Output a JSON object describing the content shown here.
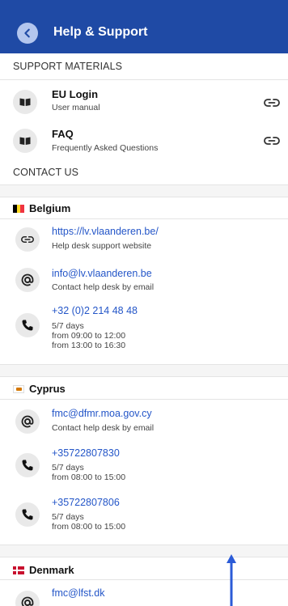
{
  "header": {
    "title": "Help & Support",
    "accent": "#1f4aa5"
  },
  "support_materials": {
    "heading": "SUPPORT MATERIALS",
    "items": [
      {
        "title": "EU Login",
        "subtitle": "User manual",
        "icon": "book-icon",
        "action_icon": "link-icon"
      },
      {
        "title": "FAQ",
        "subtitle": "Frequently Asked Questions",
        "icon": "book-icon",
        "action_icon": "link-icon"
      }
    ]
  },
  "contact": {
    "heading": "CONTACT US",
    "countries": [
      {
        "name": "Belgium",
        "flag_colors": [
          "#000000",
          "#fdda24",
          "#ef3340"
        ],
        "contacts": [
          {
            "icon": "link-icon",
            "link": "https://lv.vlaanderen.be/",
            "lines": [
              "Help desk support website"
            ]
          },
          {
            "icon": "at-icon",
            "link": "info@lv.vlaanderen.be",
            "lines": [
              "Contact help desk by email"
            ]
          },
          {
            "icon": "phone-icon",
            "link": "+32 (0)2 214 48 48",
            "lines": [
              "5/7 days",
              "from 09:00 to 12:00",
              "from 13:00 to 16:30"
            ]
          }
        ]
      },
      {
        "name": "Cyprus",
        "flag_colors": [
          "#ffffff",
          "#d57800"
        ],
        "contacts": [
          {
            "icon": "at-icon",
            "link": "fmc@dfmr.moa.gov.cy",
            "lines": [
              "Contact help desk by email"
            ]
          },
          {
            "icon": "phone-icon",
            "link": "+35722807830",
            "lines": [
              "5/7 days",
              "from 08:00 to 15:00"
            ]
          },
          {
            "icon": "phone-icon",
            "link": "+35722807806",
            "lines": [
              "5/7 days",
              "from 08:00 to 15:00"
            ]
          }
        ]
      },
      {
        "name": "Denmark",
        "flag_colors": [
          "#c8102e",
          "#ffffff"
        ],
        "contacts": [
          {
            "icon": "at-icon",
            "link": "fmc@lfst.dk",
            "lines": []
          }
        ]
      }
    ]
  },
  "annotation_arrow_color": "#2b5bd7"
}
